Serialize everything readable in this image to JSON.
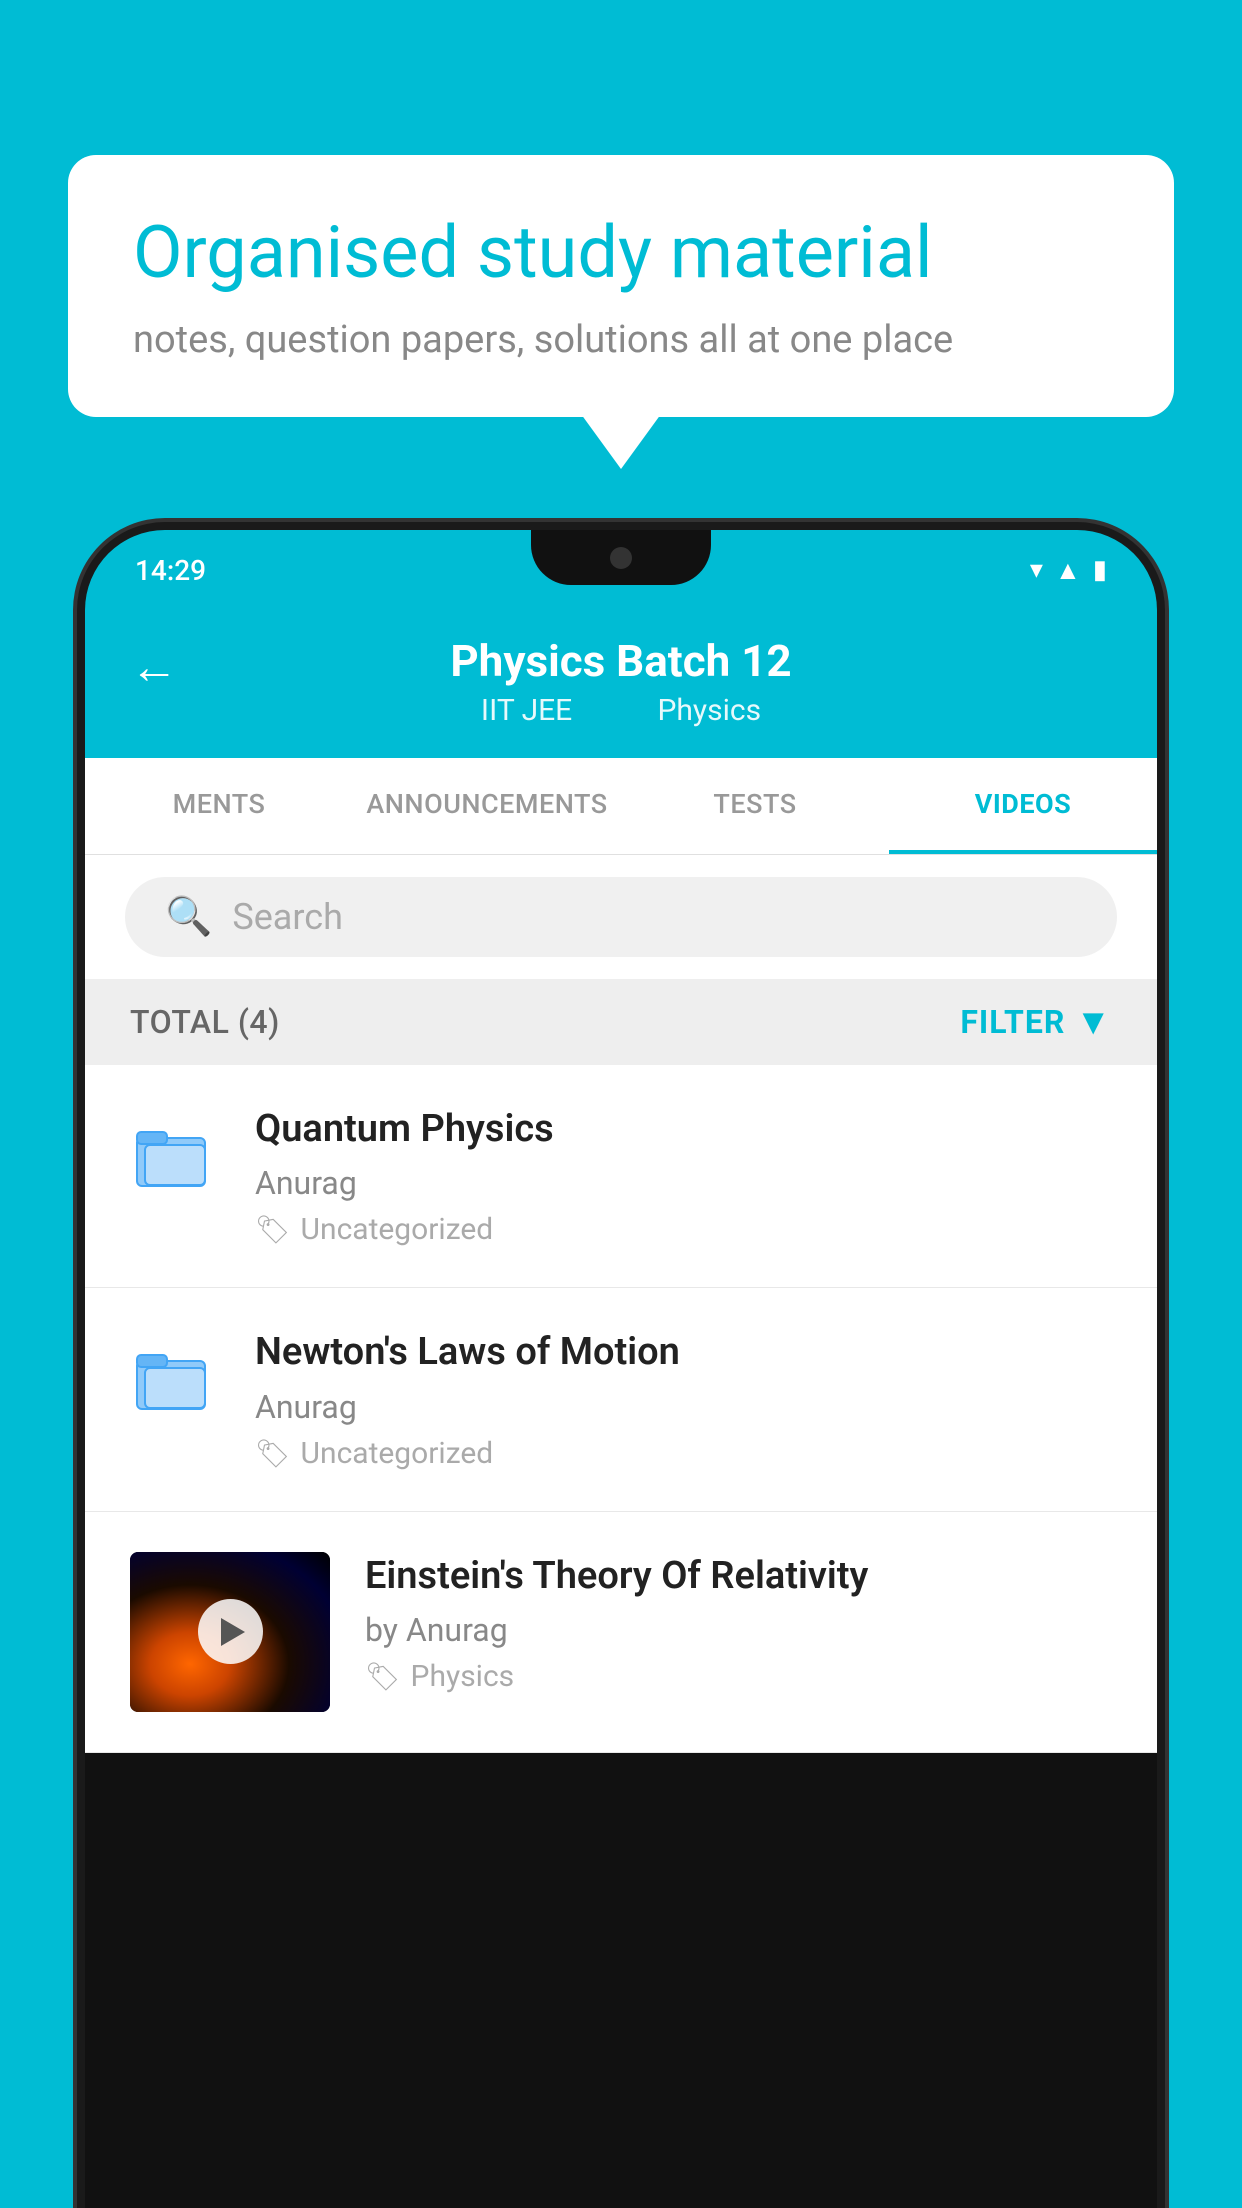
{
  "background_color": "#00BCD4",
  "speech_bubble": {
    "title": "Organised study material",
    "subtitle": "notes, question papers, solutions all at one place"
  },
  "phone": {
    "status_bar": {
      "time": "14:29"
    },
    "header": {
      "back_label": "←",
      "title": "Physics Batch 12",
      "subtitle_left": "IIT JEE",
      "subtitle_right": "Physics"
    },
    "tabs": [
      {
        "label": "MENTS",
        "active": false
      },
      {
        "label": "ANNOUNCEMENTS",
        "active": false
      },
      {
        "label": "TESTS",
        "active": false
      },
      {
        "label": "VIDEOS",
        "active": true
      }
    ],
    "search": {
      "placeholder": "Search"
    },
    "filter_bar": {
      "total_label": "TOTAL (4)",
      "filter_label": "FILTER"
    },
    "videos": [
      {
        "title": "Quantum Physics",
        "author": "Anurag",
        "tag": "Uncategorized",
        "has_thumbnail": false
      },
      {
        "title": "Newton's Laws of Motion",
        "author": "Anurag",
        "tag": "Uncategorized",
        "has_thumbnail": false
      },
      {
        "title": "Einstein's Theory Of Relativity",
        "author": "by Anurag",
        "tag": "Physics",
        "has_thumbnail": true
      }
    ]
  }
}
